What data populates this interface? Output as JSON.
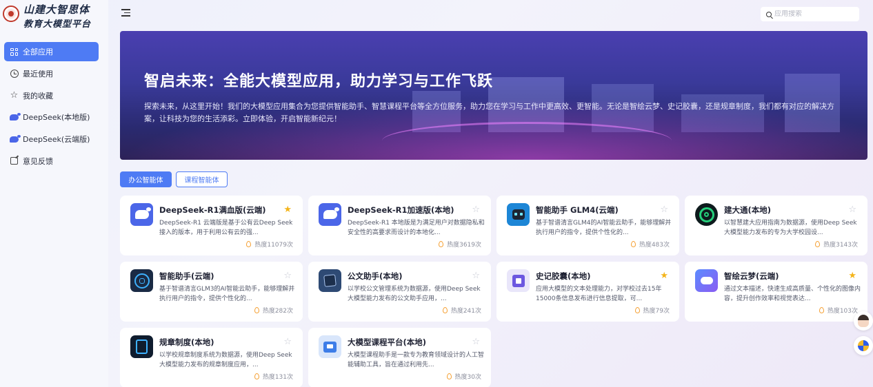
{
  "brand": {
    "line1": "山建大智思体",
    "line2": "教育大模型平台"
  },
  "sidebar": {
    "items": [
      {
        "label": "全部应用",
        "icon": "grid-icon",
        "active": true
      },
      {
        "label": "最近使用",
        "icon": "clock-icon"
      },
      {
        "label": "我的收藏",
        "icon": "star-icon"
      },
      {
        "label": "DeepSeek(本地版)",
        "icon": "deepseek-icon"
      },
      {
        "label": "DeepSeek(云端版)",
        "icon": "deepseek-icon"
      },
      {
        "label": "意见反馈",
        "icon": "edit-icon"
      }
    ]
  },
  "search": {
    "placeholder": "应用搜索",
    "value": ""
  },
  "banner": {
    "title": "智启未来：全能大模型应用，助力学习与工作飞跃",
    "description": "探索未来，从这里开始！我们的大模型应用集合为您提供智能助手、智慧课程平台等全方位服务，助力您在学习与工作中更高效、更智能。无论是智绘云梦、史记胶囊，还是规章制度，我们都有对应的解决方案，让科技为您的生活添彩。立即体验，开启智能新纪元！"
  },
  "tabs": [
    {
      "label": "办公智能体",
      "active": true
    },
    {
      "label": "课程智能体",
      "active": false
    }
  ],
  "apps": [
    {
      "title": "DeepSeek-R1满血版(云端)",
      "desc": "DeepSeek-R1 云端版是基于公有云Deep Seek接入的版本，用于利用公有云的强...",
      "heat": "热度11079次",
      "favorited": true,
      "icon": "deepseek-icon"
    },
    {
      "title": "DeepSeek-R1加速版(本地)",
      "desc": "DeepSeek-R1 本地版是为满足用户对数据隐私和安全性的高要求而设计的本地化...",
      "heat": "热度3619次",
      "favorited": false,
      "icon": "deepseek-icon"
    },
    {
      "title": "智能助手 GLM4(云端)",
      "desc": "基于智谱清言GLM4的AI智能云助手，能够理解并执行用户的指令，提供个性化的...",
      "heat": "热度483次",
      "favorited": false,
      "icon": "robot-icon"
    },
    {
      "title": "建大通(本地)",
      "desc": "以智慧建大应用指南为数据源，使用Deep Seek大模型能力发布的专为大学校园设...",
      "heat": "热度3143次",
      "favorited": false,
      "icon": "jiandatong-icon"
    },
    {
      "title": "智能助手(云端)",
      "desc": "基于智谱清言GLM3的AI智能云助手，能够理解并执行用户的指令，提供个性化的...",
      "heat": "热度282次",
      "favorited": false,
      "icon": "ai-assistant-icon"
    },
    {
      "title": "公文助手(本地)",
      "desc": "以学校公文管理系统为数据源，使用Deep Seek大模型能力发布的公文助手应用，...",
      "heat": "热度241次",
      "favorited": false,
      "icon": "document-icon"
    },
    {
      "title": "史记胶囊(本地)",
      "desc": "应用大模型的文本处理能力，对学校过去15年15000条信息发布进行信息提取，可...",
      "heat": "热度79次",
      "favorited": true,
      "icon": "history-capsule-icon"
    },
    {
      "title": "智绘云梦(云端)",
      "desc": "通过文本描述，快速生成高质量、个性化的图像内容，提升创作效率和视觉表达...",
      "heat": "热度103次",
      "favorited": true,
      "icon": "cloud-paint-icon"
    },
    {
      "title": "规章制度(本地)",
      "desc": "以学校规章制度系统为数据源，使用Deep Seek大模型能力发布的规章制度应用，...",
      "heat": "热度131次",
      "favorited": false,
      "icon": "rules-icon"
    },
    {
      "title": "大模型课程平台(本地)",
      "desc": "大模型课程助手是一款专为教育领域设计的人工智能辅助工具，旨在通过利用先...",
      "heat": "热度30次",
      "favorited": false,
      "icon": "course-icon"
    }
  ],
  "colors": {
    "accent": "#4e7bf4",
    "star": "#f4b41a",
    "flame": "#f5a033"
  }
}
